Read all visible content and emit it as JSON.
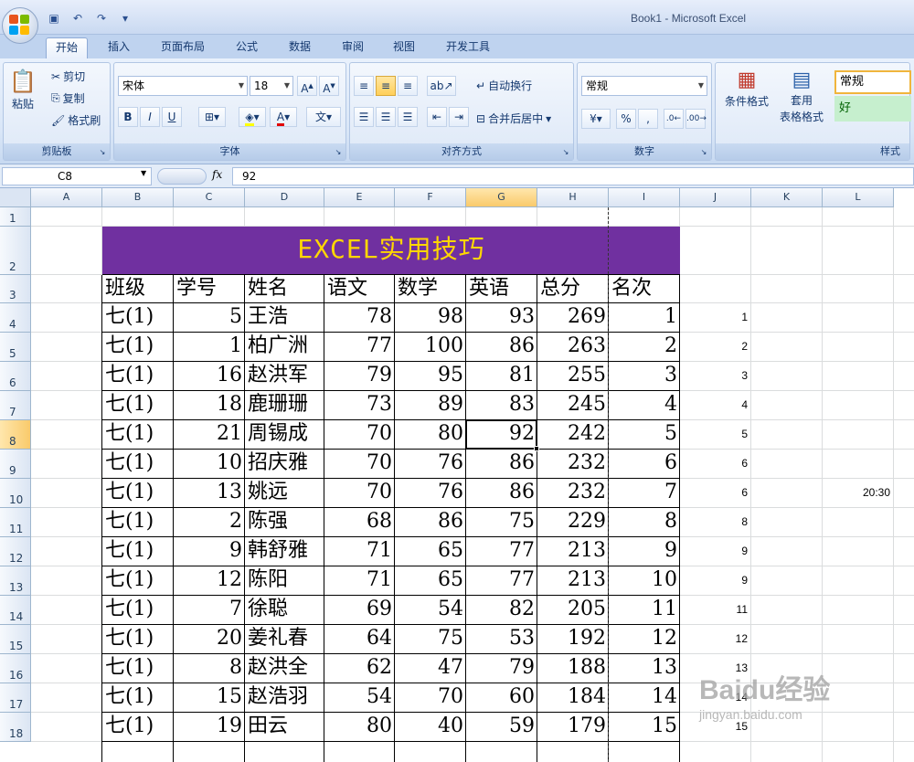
{
  "window": {
    "title": "Book1 - Microsoft Excel"
  },
  "tabs": [
    "开始",
    "插入",
    "页面布局",
    "公式",
    "数据",
    "审阅",
    "视图",
    "开发工具"
  ],
  "clipboard": {
    "paste": "粘贴",
    "cut": "剪切",
    "copy": "复制",
    "format_painter": "格式刷",
    "label": "剪贴板"
  },
  "font": {
    "name": "宋体",
    "size": "18",
    "label": "字体",
    "bold": "B",
    "italic": "I",
    "underline": "U"
  },
  "alignment": {
    "wrap": "自动换行",
    "merge": "合并后居中",
    "label": "对齐方式"
  },
  "number": {
    "format": "常规",
    "percent": "%",
    "comma": ",",
    "label": "数字"
  },
  "styles": {
    "conditional": "条件格式",
    "table_format_1": "套用",
    "table_format_2": "表格格式",
    "normal": "常规",
    "good": "好",
    "label": "样式"
  },
  "formula_bar": {
    "cell_ref": "C8",
    "fx": "fx",
    "content": "92"
  },
  "columns": [
    "A",
    "B",
    "C",
    "D",
    "E",
    "F",
    "G",
    "H",
    "I",
    "J",
    "K",
    "L"
  ],
  "rows": [
    "1",
    "2",
    "3",
    "4",
    "5",
    "6",
    "7",
    "8",
    "9",
    "10",
    "11",
    "12",
    "13",
    "14",
    "15",
    "16",
    "17",
    "18"
  ],
  "banner_title": "EXCEL实用技巧",
  "headers": [
    "班级",
    "学号",
    "姓名",
    "语文",
    "数学",
    "英语",
    "总分",
    "名次"
  ],
  "records": [
    [
      "七(1)",
      "5",
      "王浩",
      "78",
      "98",
      "93",
      "269",
      "1",
      "1"
    ],
    [
      "七(1)",
      "1",
      "柏广洲",
      "77",
      "100",
      "86",
      "263",
      "2",
      "2"
    ],
    [
      "七(1)",
      "16",
      "赵洪军",
      "79",
      "95",
      "81",
      "255",
      "3",
      "3"
    ],
    [
      "七(1)",
      "18",
      "鹿珊珊",
      "73",
      "89",
      "83",
      "245",
      "4",
      "4"
    ],
    [
      "七(1)",
      "21",
      "周锡成",
      "70",
      "80",
      "92",
      "242",
      "5",
      "5"
    ],
    [
      "七(1)",
      "10",
      "招庆雅",
      "70",
      "76",
      "86",
      "232",
      "6",
      "6"
    ],
    [
      "七(1)",
      "13",
      "姚远",
      "70",
      "76",
      "86",
      "232",
      "7",
      "6"
    ],
    [
      "七(1)",
      "2",
      "陈强",
      "68",
      "86",
      "75",
      "229",
      "8",
      "8"
    ],
    [
      "七(1)",
      "9",
      "韩舒雅",
      "71",
      "65",
      "77",
      "213",
      "9",
      "9"
    ],
    [
      "七(1)",
      "12",
      "陈阳",
      "71",
      "65",
      "77",
      "213",
      "10",
      "9"
    ],
    [
      "七(1)",
      "7",
      "徐聪",
      "69",
      "54",
      "82",
      "205",
      "11",
      "11"
    ],
    [
      "七(1)",
      "20",
      "姜礼春",
      "64",
      "75",
      "53",
      "192",
      "12",
      "12"
    ],
    [
      "七(1)",
      "8",
      "赵洪全",
      "62",
      "47",
      "79",
      "188",
      "13",
      "13"
    ],
    [
      "七(1)",
      "15",
      "赵浩羽",
      "54",
      "70",
      "60",
      "184",
      "14",
      "14"
    ],
    [
      "七(1)",
      "19",
      "田云",
      "80",
      "40",
      "59",
      "179",
      "15",
      "15"
    ]
  ],
  "timestamp": "20:30",
  "watermark": {
    "logo": "Baidu经验",
    "url": "jingyan.baidu.com"
  }
}
